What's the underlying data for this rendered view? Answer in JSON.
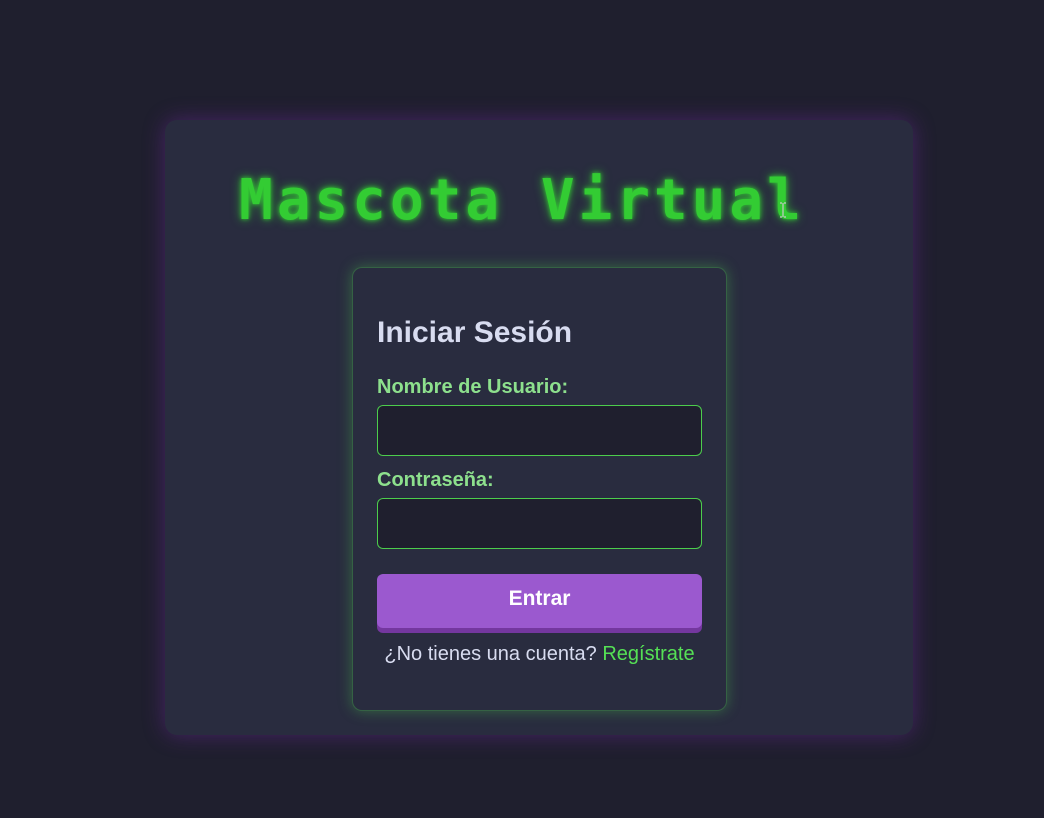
{
  "app": {
    "title": "Mascota Virtual"
  },
  "login_form": {
    "heading": "Iniciar Sesión",
    "username_label": "Nombre de Usuario:",
    "username_value": "",
    "password_label": "Contraseña:",
    "password_value": "",
    "submit_label": "Entrar",
    "no_account_text": "¿No tienes una cuenta?",
    "register_link": "Regístrate"
  },
  "colors": {
    "background": "#1f1f2e",
    "card": "#292c3f",
    "accent_green": "#33cc33",
    "label_green": "#8de08d",
    "button_purple": "#9b59cf",
    "text_light": "#d8dcf0"
  },
  "icons": {
    "cursor": "text-cursor-icon"
  }
}
